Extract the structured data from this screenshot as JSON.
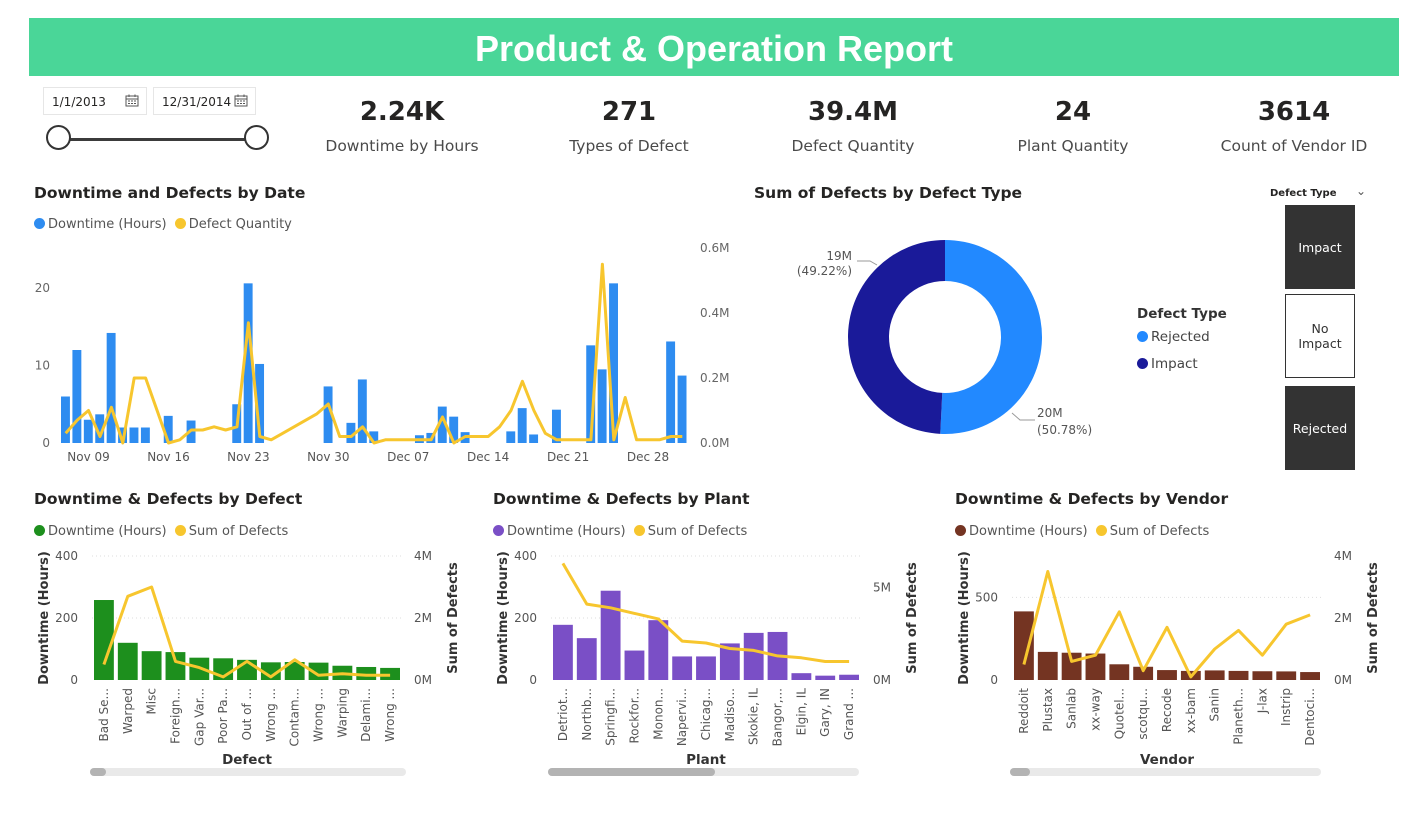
{
  "header": {
    "title": "Product & Operation Report"
  },
  "date_filter": {
    "start": "1/1/2013",
    "end": "12/31/2014",
    "calendar_icon": "calendar-icon"
  },
  "kpis": [
    {
      "value": "2.24K",
      "label": "Downtime by Hours"
    },
    {
      "value": "271",
      "label": "Types of Defect"
    },
    {
      "value": "39.4M",
      "label": "Defect Quantity"
    },
    {
      "value": "24",
      "label": "Plant Quantity"
    },
    {
      "value": "3614",
      "label": "Count of Vendor ID"
    }
  ],
  "colors": {
    "banner": "#4ad698",
    "blue": "#2e8cf0",
    "yellow": "#f7c62e",
    "green": "#1d8f1d",
    "purple": "#7a4fc6",
    "brown": "#743422",
    "navy": "#1a1a99",
    "lightblue": "#2289ff"
  },
  "charts": {
    "date": {
      "title": "Downtime and Defects by Date",
      "legend": [
        "Downtime (Hours)",
        "Defect Quantity"
      ],
      "left_ticks": [
        "0",
        "10",
        "20"
      ],
      "right_ticks": [
        "0.0M",
        "0.2M",
        "0.4M",
        "0.6M"
      ],
      "x_ticks": [
        "Nov 09",
        "Nov 16",
        "Nov 23",
        "Nov 30",
        "Dec 07",
        "Dec 14",
        "Dec 21",
        "Dec 28"
      ]
    },
    "donut": {
      "title": "Sum of Defects by Defect Type",
      "legend_title": "Defect Type",
      "legend": [
        "Rejected",
        "Impact"
      ],
      "labels": [
        {
          "value": "20M",
          "pct": "(50.78%)"
        },
        {
          "value": "19M",
          "pct": "(49.22%)"
        }
      ]
    },
    "defect": {
      "title": "Downtime & Defects by Defect",
      "legend": [
        "Downtime (Hours)",
        "Sum of Defects"
      ],
      "left_ticks": [
        "0",
        "200",
        "400"
      ],
      "right_ticks": [
        "0M",
        "2M",
        "4M"
      ],
      "y_left_title": "Downtime (Hours)",
      "y_right_title": "Sum of Defects",
      "x_title": "Defect"
    },
    "plant": {
      "title": "Downtime & Defects by Plant",
      "legend": [
        "Downtime (Hours)",
        "Sum of Defects"
      ],
      "left_ticks": [
        "0",
        "200",
        "400"
      ],
      "right_ticks": [
        "0M",
        "5M"
      ],
      "y_left_title": "Downtime (Hours)",
      "y_right_title": "Sum of Defects",
      "x_title": "Plant"
    },
    "vendor": {
      "title": "Downtime & Defects by Vendor",
      "legend": [
        "Downtime (Hours)",
        "Sum of Defects"
      ],
      "left_ticks": [
        "0",
        "500"
      ],
      "right_ticks": [
        "0M",
        "2M",
        "4M"
      ],
      "y_left_title": "Downtime (Hours)",
      "y_right_title": "Sum of Defects",
      "x_title": "Vendor"
    }
  },
  "slicer": {
    "title": "Defect Type",
    "items": [
      "Impact",
      "No Impact",
      "Rejected"
    ]
  },
  "chart_data": [
    {
      "type": "bar",
      "title": "Downtime and Defects by Date",
      "x": [
        "Nov 07",
        "Nov 08",
        "Nov 09",
        "Nov 10",
        "Nov 11",
        "Nov 12",
        "Nov 13",
        "Nov 14",
        "Nov 15",
        "Nov 16",
        "Nov 17",
        "Nov 18",
        "Nov 19",
        "Nov 20",
        "Nov 21",
        "Nov 22",
        "Nov 23",
        "Nov 24",
        "Nov 25",
        "Nov 26",
        "Nov 27",
        "Nov 28",
        "Nov 29",
        "Nov 30",
        "Dec 01",
        "Dec 02",
        "Dec 03",
        "Dec 04",
        "Dec 05",
        "Dec 06",
        "Dec 07",
        "Dec 08",
        "Dec 09",
        "Dec 10",
        "Dec 11",
        "Dec 12",
        "Dec 13",
        "Dec 14",
        "Dec 15",
        "Dec 16",
        "Dec 17",
        "Dec 18",
        "Dec 19",
        "Dec 20",
        "Dec 21",
        "Dec 22",
        "Dec 23",
        "Dec 24",
        "Dec 25",
        "Dec 26",
        "Dec 27",
        "Dec 28",
        "Dec 29",
        "Dec 30",
        "Dec 31"
      ],
      "series": [
        {
          "name": "Downtime (Hours)",
          "axis": "left",
          "values": [
            6,
            12,
            3,
            3.7,
            14.2,
            2,
            2,
            2,
            0,
            3.5,
            0,
            2.9,
            0,
            0,
            0,
            5,
            20.6,
            10.2,
            0,
            0,
            0,
            0,
            0,
            7.3,
            0,
            2.6,
            8.2,
            1.5,
            0,
            0,
            0,
            1,
            1.3,
            4.7,
            3.4,
            1.4,
            0,
            0,
            0,
            1.5,
            4.5,
            1.1,
            0,
            4.3,
            0,
            0,
            12.6,
            9.5,
            20.6,
            0,
            0,
            0,
            0,
            13.1,
            8.7,
            10.2
          ]
        },
        {
          "name": "Defect Quantity",
          "axis": "right",
          "values": [
            0.03,
            0.07,
            0.1,
            0.02,
            0.11,
            0.0,
            0.2,
            0.2,
            0.1,
            0.0,
            0.01,
            0.04,
            0.04,
            0.05,
            0.04,
            0.05,
            0.37,
            0.02,
            0.01,
            0.03,
            0.05,
            0.07,
            0.09,
            0.12,
            0.02,
            0.02,
            0.05,
            0.0,
            0.01,
            0.01,
            0.01,
            0.01,
            0.01,
            0.08,
            0.0,
            0.02,
            0.02,
            0.02,
            0.05,
            0.1,
            0.19,
            0.1,
            0.03,
            0.01,
            0.01,
            0.01,
            0.01,
            0.55,
            0.01,
            0.14,
            0.01,
            0.01,
            0.01,
            0.02,
            0.02,
            0.03
          ]
        }
      ],
      "ylim_left": [
        0,
        25
      ],
      "ylim_right": [
        0,
        0.6
      ]
    },
    {
      "type": "pie",
      "title": "Sum of Defects by Defect Type",
      "categories": [
        "Rejected",
        "Impact"
      ],
      "values": [
        20,
        19
      ],
      "percent": [
        50.78,
        49.22
      ]
    },
    {
      "type": "bar",
      "title": "Downtime & Defects by Defect",
      "categories": [
        "Bad Se...",
        "Warped",
        "Misc",
        "Foreign...",
        "Gap Var...",
        "Poor Pa...",
        "Out of ...",
        "Wrong ...",
        "Contam...",
        "Wrong ...",
        "Warping",
        "Delami...",
        "Wrong ..."
      ],
      "series": [
        {
          "name": "Downtime (Hours)",
          "axis": "left",
          "values": [
            258,
            120,
            93,
            90,
            72,
            70,
            65,
            57,
            58,
            56,
            46,
            42,
            39
          ]
        },
        {
          "name": "Sum of Defects",
          "axis": "right",
          "values": [
            0.5,
            2.7,
            3.0,
            0.6,
            0.4,
            0.1,
            0.6,
            0.1,
            0.65,
            0.15,
            0.2,
            0.15,
            0.15
          ]
        }
      ],
      "ylim_left": [
        0,
        400
      ],
      "ylim_right": [
        0,
        4
      ]
    },
    {
      "type": "bar",
      "title": "Downtime & Defects by Plant",
      "categories": [
        "Detriot...",
        "Northb...",
        "Springfi...",
        "Rockfor...",
        "Monon...",
        "Napervi...",
        "Chicag...",
        "Madiso...",
        "Skokie, IL",
        "Bangor,...",
        "Elgin, IL",
        "Gary, IN",
        "Grand ..."
      ],
      "series": [
        {
          "name": "Downtime (Hours)",
          "axis": "left",
          "values": [
            178,
            135,
            288,
            95,
            193,
            76,
            76,
            118,
            152,
            155,
            22,
            14,
            17
          ]
        },
        {
          "name": "Sum of Defects",
          "axis": "right",
          "values": [
            6.3,
            4.1,
            3.9,
            3.6,
            3.3,
            2.1,
            2.0,
            1.7,
            1.6,
            1.3,
            1.2,
            1.0,
            1.0
          ]
        }
      ],
      "ylim_left": [
        0,
        400
      ],
      "ylim_right": [
        0,
        6.7
      ]
    },
    {
      "type": "bar",
      "title": "Downtime & Defects by Vendor",
      "categories": [
        "Reddoit",
        "Plustax",
        "Sanlab",
        "xx-way",
        "Quotel...",
        "scotqu...",
        "Recode",
        "xx-bam",
        "Sanin",
        "Planeth...",
        "J-lax",
        "Instrip",
        "Dentoci..."
      ],
      "series": [
        {
          "name": "Downtime (Hours)",
          "axis": "left",
          "values": [
            415,
            170,
            165,
            160,
            95,
            80,
            60,
            55,
            58,
            55,
            53,
            52,
            48
          ]
        },
        {
          "name": "Sum of Defects",
          "axis": "right",
          "values": [
            0.5,
            3.5,
            0.6,
            0.8,
            2.2,
            0.3,
            1.7,
            0.1,
            1.0,
            1.6,
            0.8,
            1.8,
            2.1
          ]
        }
      ],
      "ylim_left": [
        0,
        750
      ],
      "ylim_right": [
        0,
        4
      ]
    }
  ]
}
